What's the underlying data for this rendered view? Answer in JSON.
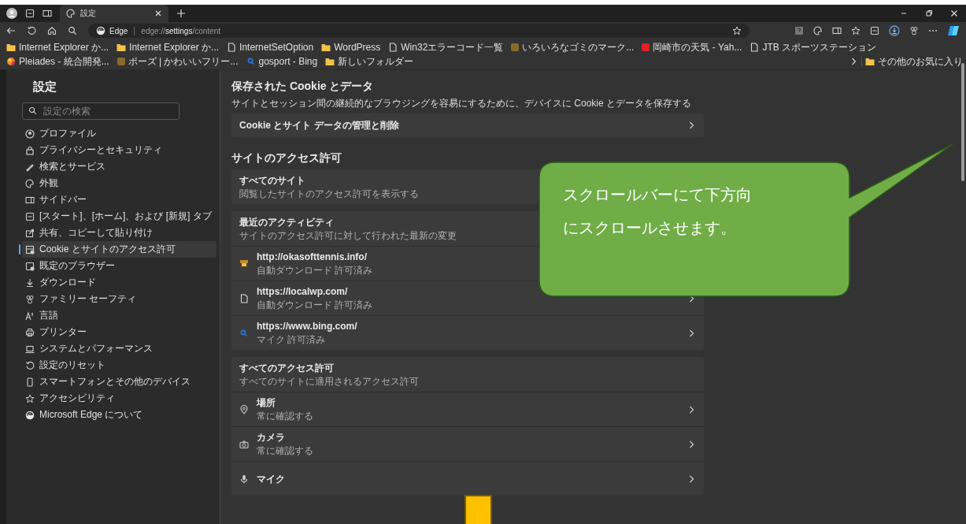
{
  "tabs": [
    {
      "label": "設定",
      "selected": true
    }
  ],
  "address_bar": {
    "site_label": "Edge",
    "url": "edge://**settings**/content"
  },
  "bookmarks": [
    {
      "label": "Internet Explorer か...",
      "kind": "folder"
    },
    {
      "label": "Internet Explorer か...",
      "kind": "folder"
    },
    {
      "label": "InternetSetOption",
      "kind": "page"
    },
    {
      "label": "WordPress",
      "kind": "folder"
    },
    {
      "label": "Win32エラーコード一覧",
      "kind": "page"
    },
    {
      "label": "いろいろなゴミのマーク...",
      "kind": "favicon",
      "color": "#8a6a2a"
    },
    {
      "label": "岡崎市の天気 - Yah...",
      "kind": "favicon",
      "color": "#e0202a"
    },
    {
      "label": "JTB スポーツステーション",
      "kind": "page"
    },
    {
      "label": "Pleiades - 統合開発...",
      "kind": "orb"
    },
    {
      "label": "ポーズ | かわいいフリー...",
      "kind": "favicon",
      "color": "#8a6a2a"
    },
    {
      "label": "gosport - Bing",
      "kind": "search"
    },
    {
      "label": "新しいフォルダー",
      "kind": "folder"
    }
  ],
  "other_favorites": {
    "label": "その他のお気に入り"
  },
  "sidebar": {
    "title": "設定",
    "search": {
      "placeholder": "設定の検索"
    },
    "items": [
      {
        "label": "プロファイル",
        "selected": false
      },
      {
        "label": "プライバシーとセキュリティ",
        "selected": false
      },
      {
        "label": "検索とサービス",
        "selected": false
      },
      {
        "label": "外観",
        "selected": false
      },
      {
        "label": "サイドバー",
        "selected": false
      },
      {
        "label": "[スタート]、[ホーム]、および [新規] タブ",
        "selected": false
      },
      {
        "label": "共有、コピーして貼り付け",
        "selected": false
      },
      {
        "label": "Cookie とサイトのアクセス許可",
        "selected": true
      },
      {
        "label": "既定のブラウザー",
        "selected": false
      },
      {
        "label": "ダウンロード",
        "selected": false
      },
      {
        "label": "ファミリー セーフティ",
        "selected": false
      },
      {
        "label": "言語",
        "selected": false
      },
      {
        "label": "プリンター",
        "selected": false
      },
      {
        "label": "システムとパフォーマンス",
        "selected": false
      },
      {
        "label": "設定のリセット",
        "selected": false
      },
      {
        "label": "スマートフォンとその他のデバイス",
        "selected": false
      },
      {
        "label": "アクセシビリティ",
        "selected": false
      },
      {
        "label": "Microsoft Edge について",
        "selected": false
      }
    ]
  },
  "cookies_section": {
    "title": "保存された Cookie とデータ",
    "description": "サイトとセッション間の継続的なブラウジングを容易にするために、デバイスに Cookie とデータを保存する",
    "link": {
      "label": "Cookie とサイト データの管理と削除",
      "chevron": true
    }
  },
  "permissions_section": {
    "title": "サイトのアクセス許可",
    "cards": [
      {
        "title": "すべてのサイト",
        "subtitle": "閲覧したサイトのアクセス許可を表示する"
      },
      {
        "title": "最近のアクティビティ",
        "subtitle": "サイトのアクセス許可に対して行われた最新の変更",
        "rows": [
          {
            "title": "http://okasofttennis.info/",
            "subtitle": "自動ダウンロード 許可済み",
            "kind": "favicon",
            "chevron": false
          },
          {
            "title": "https://localwp.com/",
            "subtitle": "自動ダウンロード 許可済み",
            "kind": "page",
            "chevron": true
          },
          {
            "title": "https://www.bing.com/",
            "subtitle": "マイク 許可済み",
            "kind": "search",
            "chevron": true
          }
        ]
      },
      {
        "title": "すべてのアクセス許可",
        "subtitle": "すべてのサイトに適用されるアクセス許可",
        "rows": [
          {
            "title": "場所",
            "subtitle": "常に確認する",
            "kind": "location",
            "chevron": true
          },
          {
            "title": "カメラ",
            "subtitle": "常に確認する",
            "kind": "camera",
            "chevron": true
          },
          {
            "title": "マイク",
            "kind": "mic",
            "chevron": true
          }
        ]
      }
    ]
  },
  "callout": {
    "text": "スクロールバーにて下方向にスクロールさせます。"
  }
}
